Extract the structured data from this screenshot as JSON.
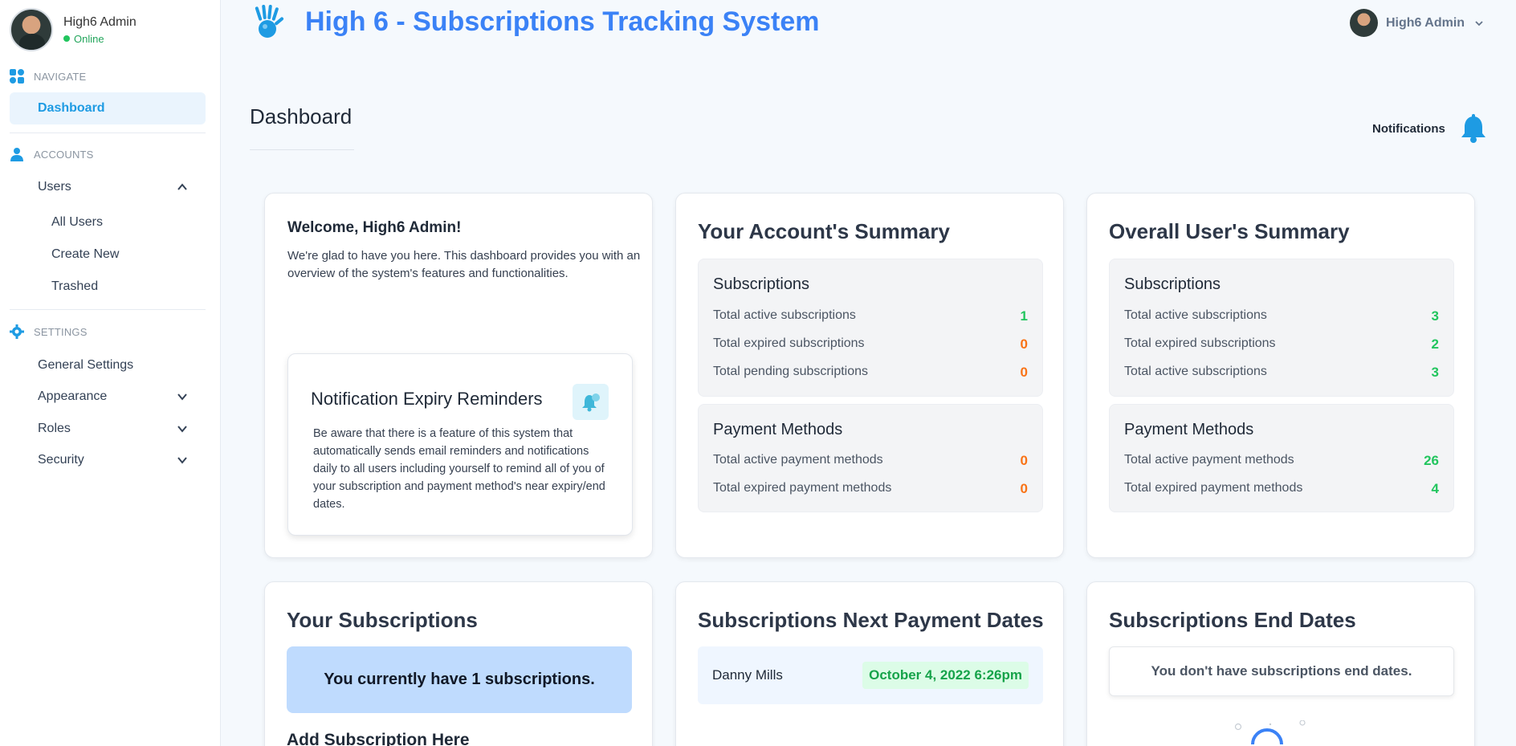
{
  "sidebar": {
    "profile": {
      "name": "High6 Admin",
      "status": "Online"
    },
    "sections": {
      "navigate": "NAVIGATE",
      "accounts": "ACCOUNTS",
      "settings": "SETTINGS"
    },
    "dashboard": "Dashboard",
    "users": "Users",
    "users_sub": [
      "All Users",
      "Create New",
      "Trashed"
    ],
    "general_settings": "General Settings",
    "appearance": "Appearance",
    "roles": "Roles",
    "security": "Security"
  },
  "header": {
    "title": "High 6 - Subscriptions Tracking System",
    "user_name": "High6 Admin"
  },
  "page": {
    "title": "Dashboard",
    "notifications_label": "Notifications"
  },
  "welcome": {
    "title": "Welcome, High6 Admin!",
    "text": "We're glad to have you here. This dashboard provides you with an overview of the system's features and functionalities.",
    "reminder_title": "Notification Expiry Reminders",
    "reminder_text": "Be aware that there is a feature of this system that automatically sends email reminders and notifications daily to all users including yourself to remind all of you of your subscription and payment method's near expiry/end dates."
  },
  "account_summary": {
    "title": "Your Account's Summary",
    "subscriptions_title": "Subscriptions",
    "subscriptions": [
      {
        "label": "Total active subscriptions",
        "value": "1",
        "color": "#22c55e"
      },
      {
        "label": "Total expired subscriptions",
        "value": "0",
        "color": "#f97316"
      },
      {
        "label": "Total pending subscriptions",
        "value": "0",
        "color": "#f97316"
      }
    ],
    "payments_title": "Payment Methods",
    "payments": [
      {
        "label": "Total active payment methods",
        "value": "0",
        "color": "#f97316"
      },
      {
        "label": "Total expired payment methods",
        "value": "0",
        "color": "#f97316"
      }
    ]
  },
  "overall_summary": {
    "title": "Overall User's Summary",
    "subscriptions_title": "Subscriptions",
    "subscriptions": [
      {
        "label": "Total active subscriptions",
        "value": "3",
        "color": "#22c55e"
      },
      {
        "label": "Total expired subscriptions",
        "value": "2",
        "color": "#22c55e"
      },
      {
        "label": "Total active subscriptions",
        "value": "3",
        "color": "#22c55e"
      }
    ],
    "payments_title": "Payment Methods",
    "payments": [
      {
        "label": "Total active payment methods",
        "value": "26",
        "color": "#22c55e"
      },
      {
        "label": "Total expired payment methods",
        "value": "4",
        "color": "#22c55e"
      }
    ]
  },
  "your_subscriptions": {
    "title": "Your Subscriptions",
    "banner": "You currently have 1 subscriptions.",
    "add_label": "Add Subscription Here"
  },
  "next_payment": {
    "title": "Subscriptions Next Payment Dates",
    "name": "Danny Mills",
    "date": "October 4, 2022 6:26pm"
  },
  "end_dates": {
    "title": "Subscriptions End Dates",
    "empty_message": "You don't have subscriptions end dates."
  },
  "colors": {
    "accent": "#1e9be3",
    "title_blue": "#3b82f6",
    "positive": "#22c55e",
    "warning": "#f97316"
  }
}
